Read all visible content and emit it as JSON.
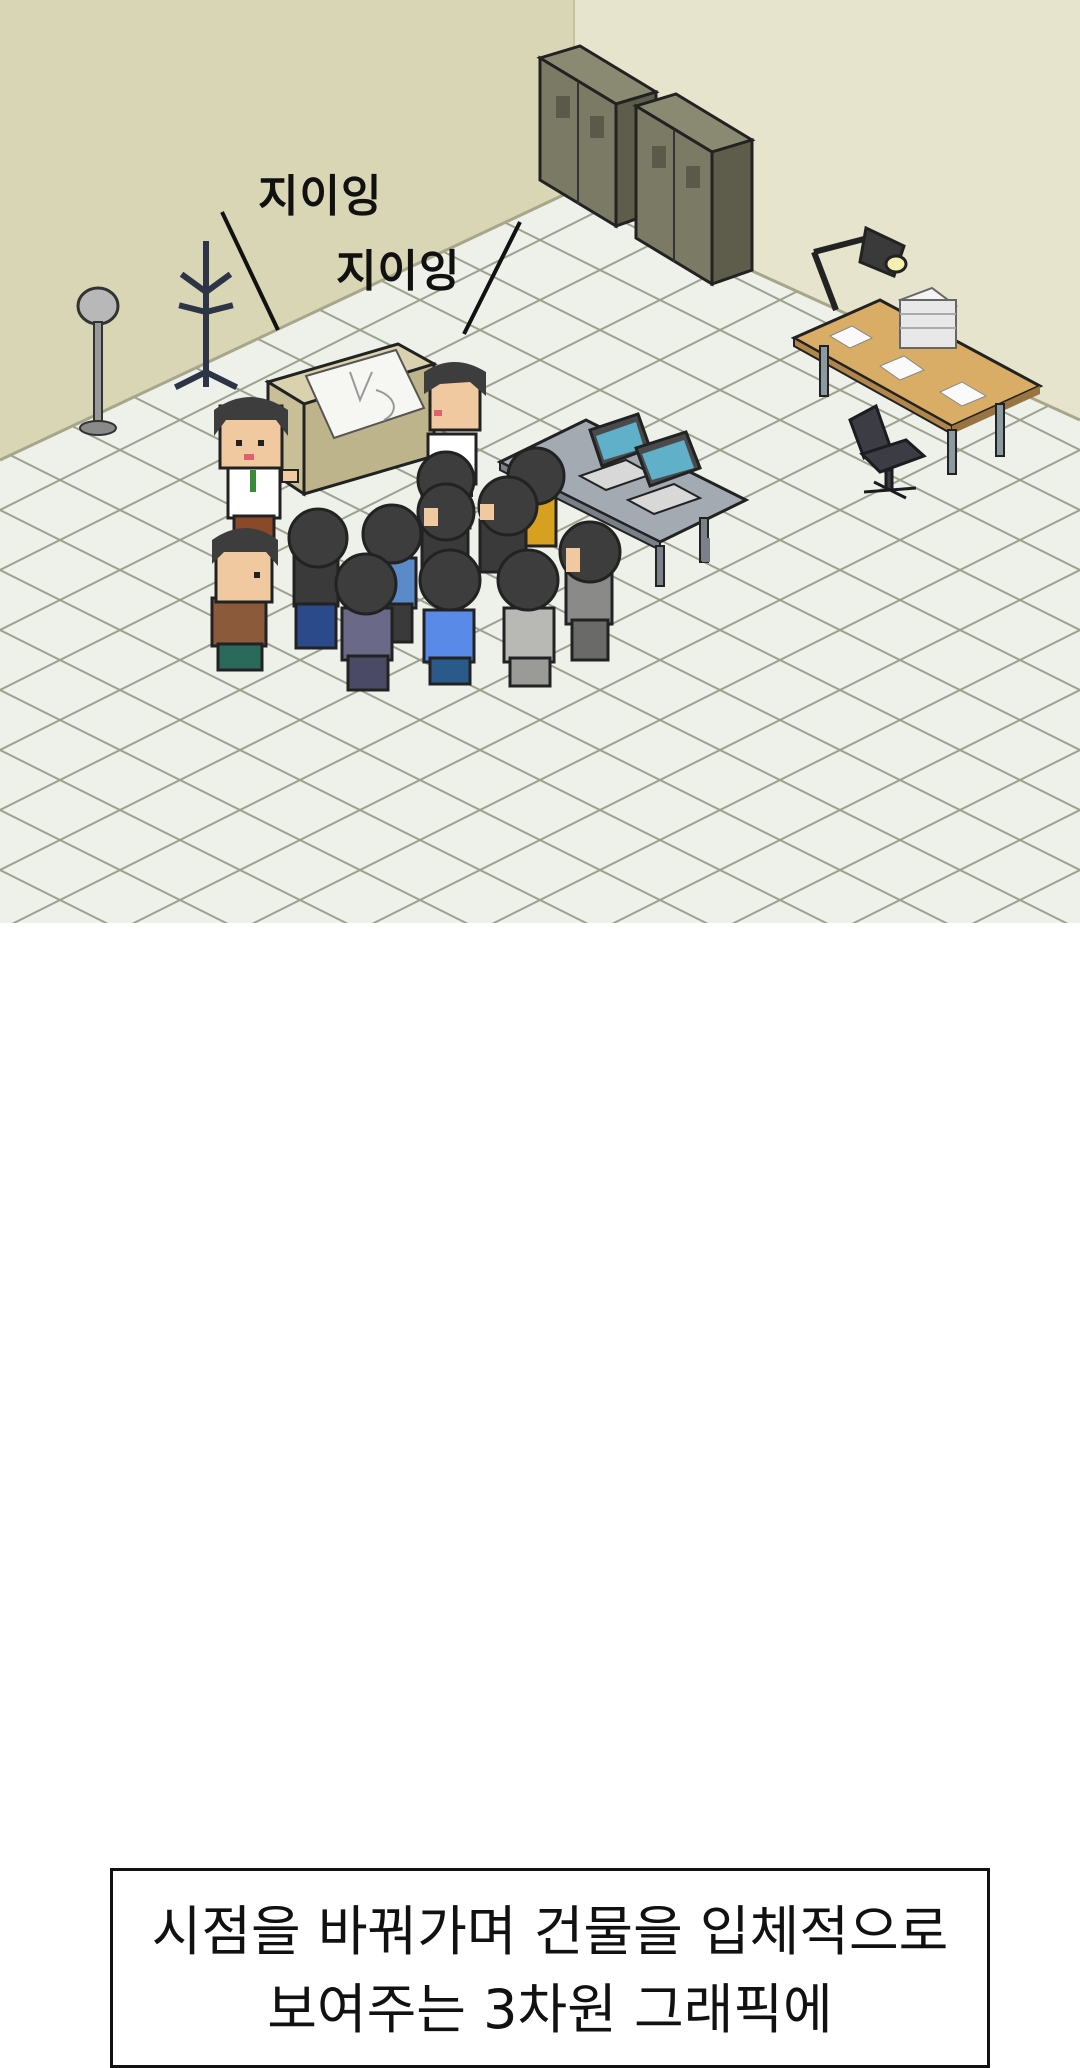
{
  "sound_effects": [
    "지이잉",
    "지이잉"
  ],
  "caption": {
    "text": "시점을 바꿔가며 건물을 입체적으로\n보여주는 3차원 그래픽에"
  },
  "colors": {
    "floor": "#eef0ea",
    "tile_line": "#9ea08e",
    "wall": "#d8d6b4",
    "wall_right": "#e6e4cc",
    "locker": "#7b7a64",
    "desk": "#d9ad66",
    "computer_table": "#a3aab2",
    "hair": "#3d3d3d",
    "skin": "#f0c9a0"
  }
}
